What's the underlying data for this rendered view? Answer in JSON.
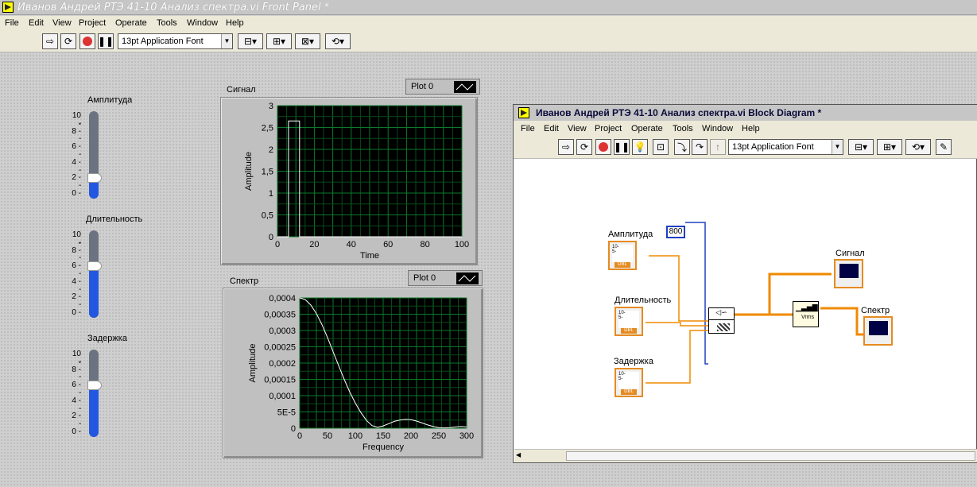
{
  "window_title": "Иванов Андрей РТЭ 41-10 Анализ спектра.vi Front Panel *",
  "menu": [
    "File",
    "Edit",
    "View",
    "Project",
    "Operate",
    "Tools",
    "Window",
    "Help"
  ],
  "font_select": "13pt Application Font",
  "sliders": [
    {
      "label": "Амплитуда",
      "ticks": [
        "10",
        "8",
        "6",
        "4",
        "2",
        "0"
      ],
      "value": 2
    },
    {
      "label": "Длительность",
      "ticks": [
        "10",
        "8",
        "6",
        "4",
        "2",
        "0"
      ],
      "value": 6
    },
    {
      "label": "Задержка",
      "ticks": [
        "10",
        "8",
        "6",
        "4",
        "2",
        "0"
      ],
      "value": 6
    }
  ],
  "signal_graph": {
    "label": "Сигнал",
    "legend": "Plot 0",
    "xlabel": "Time",
    "ylabel": "Amplitude",
    "xticks": [
      "0",
      "20",
      "40",
      "60",
      "80",
      "100"
    ],
    "yticks": [
      "3",
      "2,5",
      "2",
      "1,5",
      "1",
      "0,5",
      "0"
    ]
  },
  "spectrum_graph": {
    "label": "Спектр",
    "legend": "Plot 0",
    "xlabel": "Frequency",
    "ylabel": "Amplitude",
    "xticks": [
      "0",
      "50",
      "100",
      "150",
      "200",
      "250",
      "300"
    ],
    "yticks": [
      "0,0004",
      "0,00035",
      "0,0003",
      "0,00025",
      "0,0002",
      "0,00015",
      "0,0001",
      "5E-5",
      "0"
    ]
  },
  "chart_data": [
    {
      "type": "line",
      "title": "Сигнал",
      "xlabel": "Time",
      "ylabel": "Amplitude",
      "xlim": [
        0,
        100
      ],
      "ylim": [
        0,
        3
      ],
      "series": [
        {
          "x": [
            0,
            6,
            6,
            12,
            12,
            100
          ],
          "y": [
            0,
            0,
            2.65,
            2.65,
            0,
            0
          ]
        }
      ]
    },
    {
      "type": "line",
      "title": "Спектр",
      "xlabel": "Frequency",
      "ylabel": "Amplitude",
      "xlim": [
        0,
        300
      ],
      "ylim": [
        0,
        0.0004
      ],
      "series": [
        {
          "x": [
            0,
            10,
            20,
            30,
            40,
            50,
            60,
            70,
            80,
            90,
            100,
            110,
            120,
            130,
            140,
            150,
            160,
            170,
            180,
            190,
            200,
            210,
            220,
            230,
            240,
            250,
            260,
            270,
            280,
            290,
            300
          ],
          "y": [
            0.0004,
            0.000395,
            0.000378,
            0.000352,
            0.000318,
            0.000278,
            0.000235,
            0.000192,
            0.00015,
            0.000111,
            7.7e-05,
            4.8e-05,
            2.4e-05,
            8e-06,
            3e-06,
            7e-06,
            1.4e-05,
            2.1e-05,
            2.5e-05,
            2.7e-05,
            2.6e-05,
            2.2e-05,
            1.6e-05,
            1e-05,
            5e-06,
            2e-06,
            1e-06,
            2e-06,
            4e-06,
            5e-06,
            4e-06
          ]
        }
      ]
    }
  ],
  "block_diagram": {
    "title": "Иванов Андрей РТЭ 41-10 Анализ спектра.vi Block Diagram *",
    "menu": [
      "File",
      "Edit",
      "View",
      "Project",
      "Operate",
      "Tools",
      "Window",
      "Help"
    ],
    "font_select": "13pt Application Font",
    "const": "800",
    "labels": {
      "amp": "Амплитуда",
      "dur": "Длительность",
      "delay": "Задержка",
      "signal": "Сигнал",
      "spectrum": "Спектр"
    },
    "dbl": "DBL"
  }
}
